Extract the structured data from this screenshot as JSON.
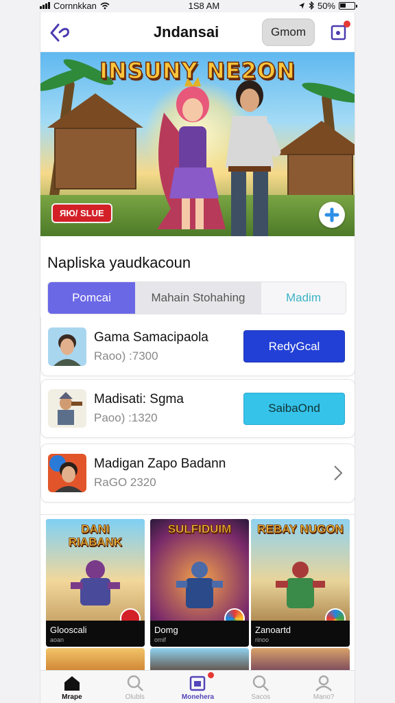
{
  "status_bar": {
    "carrier": "Cornnkkan",
    "time": "1S8 AM",
    "battery": "50%"
  },
  "header": {
    "title": "Jndansai",
    "pill_label": "Gmom"
  },
  "hero": {
    "title": "INSUNY NE2ON",
    "badge": "ЯЮ/ SLUE"
  },
  "section": {
    "title": "Napliska yaudkacoun"
  },
  "tabs": [
    {
      "label": "Pomcai",
      "selected": true
    },
    {
      "label": "Mahain Stohahing",
      "selected": false
    },
    {
      "label": "Madim",
      "selected": false
    }
  ],
  "list": [
    {
      "name": "Gama Samacipaola",
      "rating": "Raoo) :7300",
      "action": "RedyGcal",
      "action_style": "blue"
    },
    {
      "name": "Madisati: Sgma",
      "rating": "Paoo) :1320",
      "action": "SaibaOnd",
      "action_style": "cyan"
    },
    {
      "name": "Madigan Zapo Badann",
      "rating": "RaGO 2320",
      "action": "",
      "action_style": "chevron"
    }
  ],
  "tiles": [
    {
      "title": "DANI\nRIABANK",
      "name": "Glooscali",
      "sub": "aoan"
    },
    {
      "title": "SULFIDUIM",
      "name": "Domg",
      "sub": "omif"
    },
    {
      "title": "REBAY NUGON",
      "name": "Zanoartd",
      "sub": "rinoo"
    }
  ],
  "tabbar": [
    {
      "label": "Mrape",
      "icon": "home-icon",
      "state": "active"
    },
    {
      "label": "Olubls",
      "icon": "search-icon",
      "state": "inactive"
    },
    {
      "label": "Monehera",
      "icon": "games-icon",
      "state": "special"
    },
    {
      "label": "Sacos",
      "icon": "search-icon",
      "state": "inactive"
    },
    {
      "label": "Mano?",
      "icon": "user-icon",
      "state": "inactive"
    }
  ],
  "colors": {
    "accent_purple": "#6b68e6",
    "button_blue": "#2340d6",
    "button_cyan": "#35c3ea",
    "badge_red": "#d32027"
  }
}
